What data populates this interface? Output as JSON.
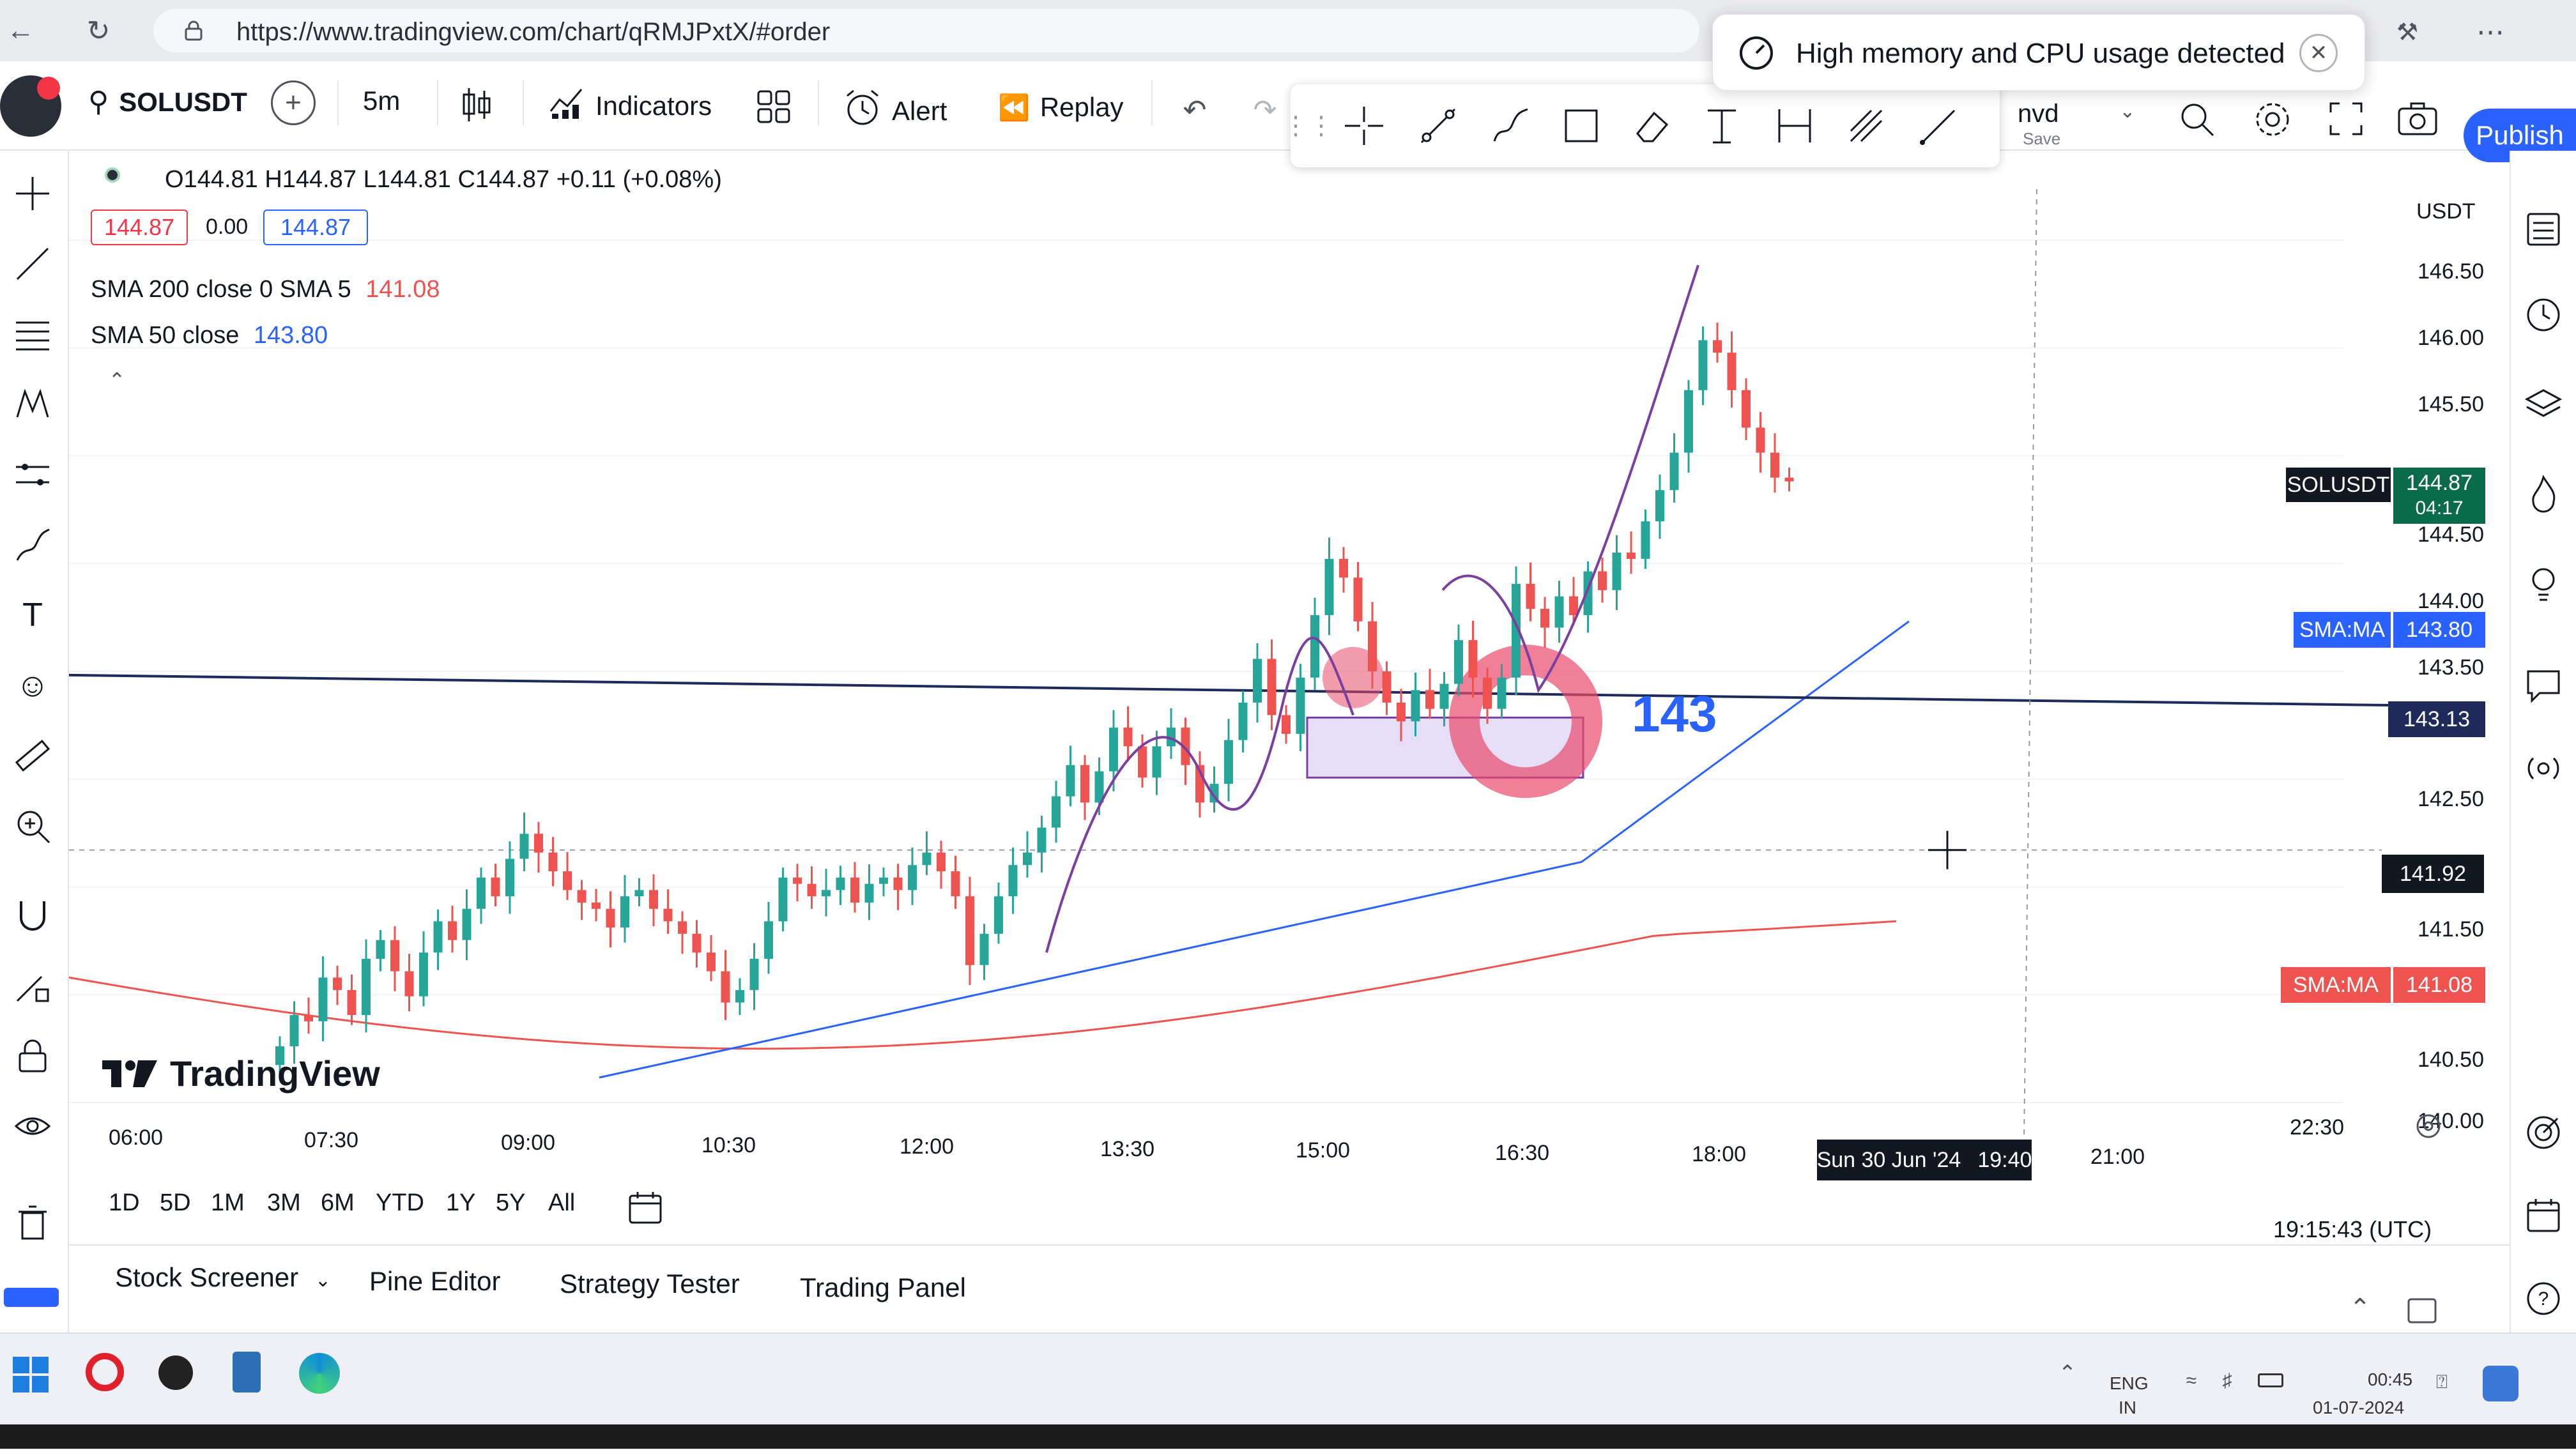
{
  "browser": {
    "url": "https://www.tradingview.com/chart/qRMJPxtX/#order"
  },
  "toast": {
    "text": "High memory and CPU usage detected"
  },
  "toolbar": {
    "symbol": "SOLUSDT",
    "interval": "5m",
    "indicators": "Indicators",
    "alert": "Alert",
    "replay": "Replay",
    "layout_name": "nvd",
    "layout_status": "Save",
    "publish": "Publish"
  },
  "legend": {
    "ohlc": "O144.81 H144.87 L144.81 C144.87 +0.11 (+0.08%)",
    "bid": "144.87",
    "spread": "0.00",
    "ask": "144.87",
    "sma1_label": "SMA 200 close 0 SMA 5",
    "sma1_value": "141.08",
    "sma2_label": "SMA 50 close",
    "sma2_value": "143.80"
  },
  "currency": "USDT",
  "watermark": "TradingView",
  "drawing_label": "143",
  "price_axis": [
    "146.50",
    "146.00",
    "145.50",
    "144.50",
    "144.00",
    "143.50",
    "142.50",
    "141.50",
    "140.50",
    "140.00"
  ],
  "price_badges": {
    "symbol_name": "SOLUSDT",
    "last_price": "144.87",
    "countdown": "04:17",
    "sma50_name": "SMA:MA",
    "sma50_value": "143.80",
    "hline_value": "143.13",
    "cursor_price": "141.92",
    "sma200_name": "SMA:MA",
    "sma200_value": "141.08"
  },
  "time_axis": [
    "06:00",
    "07:30",
    "09:00",
    "10:30",
    "12:00",
    "13:30",
    "15:00",
    "16:30",
    "18:00",
    "21:00",
    "22:30"
  ],
  "cursor_time": {
    "date": "Sun 30 Jun '24",
    "time": "19:40"
  },
  "clock": "19:15:43 (UTC)",
  "ranges": [
    "1D",
    "5D",
    "1M",
    "3M",
    "6M",
    "YTD",
    "1Y",
    "5Y",
    "All"
  ],
  "bottom_tabs": [
    "Stock Screener",
    "Pine Editor",
    "Strategy Tester",
    "Trading Panel"
  ],
  "taskbar": {
    "lang": "ENG",
    "region": "IN",
    "time": "00:45",
    "date": "01-07-2024"
  },
  "colors": {
    "up": "#26a69a",
    "down": "#ef5350",
    "sma50": "#2962ff",
    "sma200": "#ef5350",
    "hline": "#1e2a5a",
    "drawing": "#7b3fa0",
    "highlight": "#e84a6b",
    "accent": "#2962ff"
  },
  "chart_data": {
    "type": "candlestick",
    "symbol": "SOLUSDT",
    "interval": "5m",
    "price_range": [
      139.9,
      146.8
    ],
    "x_labels": [
      "06:00",
      "07:30",
      "09:00",
      "10:30",
      "12:00",
      "13:30",
      "15:00",
      "16:30",
      "18:00",
      "21:00",
      "22:30"
    ],
    "close": [
      140.35,
      140.6,
      140.55,
      140.9,
      140.8,
      140.6,
      141.05,
      141.2,
      140.95,
      140.75,
      141.1,
      141.35,
      141.2,
      141.45,
      141.7,
      141.55,
      141.85,
      142.05,
      141.9,
      141.75,
      141.6,
      141.5,
      141.45,
      141.3,
      141.55,
      141.6,
      141.45,
      141.35,
      141.25,
      141.1,
      140.95,
      140.7,
      140.8,
      141.05,
      141.35,
      141.7,
      141.65,
      141.55,
      141.6,
      141.7,
      141.5,
      141.65,
      141.7,
      141.6,
      141.8,
      141.9,
      141.75,
      141.55,
      141.0,
      141.25,
      141.55,
      141.8,
      141.9,
      142.1,
      142.35,
      142.6,
      142.3,
      142.55,
      142.9,
      142.75,
      142.5,
      142.75,
      142.9,
      142.6,
      142.3,
      142.45,
      142.8,
      143.1,
      143.45,
      143.0,
      142.85,
      143.3,
      143.8,
      144.25,
      144.1,
      143.75,
      143.35,
      143.1,
      142.95,
      143.2,
      143.05,
      143.25,
      143.6,
      143.3,
      143.05,
      143.3,
      144.05,
      143.85,
      143.7,
      143.95,
      143.8,
      144.15,
      144.0,
      144.3,
      144.25,
      144.55,
      144.8,
      145.1,
      145.6,
      146.0,
      145.9,
      145.6,
      145.3,
      145.1,
      144.9,
      144.87
    ],
    "sma50": {
      "last": 143.8
    },
    "sma200": {
      "last": 141.08
    },
    "horizontal_line": 143.13,
    "cursor": {
      "price": 141.92,
      "time": "Sun 30 Jun '24 19:40"
    }
  }
}
